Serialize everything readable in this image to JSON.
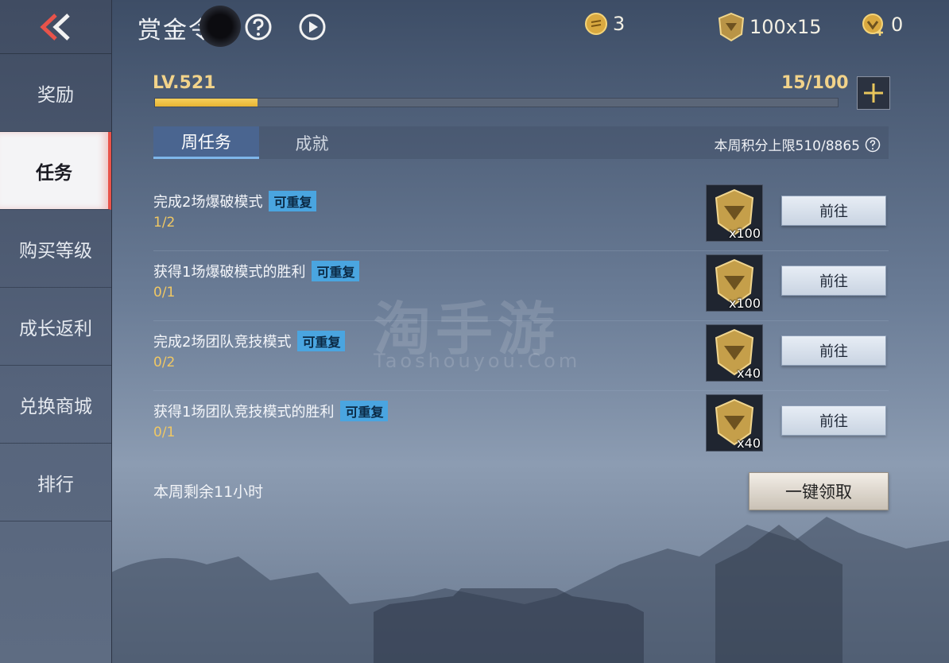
{
  "header": {
    "title": "赏金令",
    "currencies": [
      {
        "icon": "coin-icon",
        "value": "3"
      },
      {
        "icon": "medal-icon",
        "value": "100x15"
      },
      {
        "icon": "vip-coin-icon",
        "value": "0"
      }
    ]
  },
  "sidebar": {
    "items": [
      {
        "label": "奖励"
      },
      {
        "label": "任务"
      },
      {
        "label": "购买等级"
      },
      {
        "label": "成长返利"
      },
      {
        "label": "兑换商城"
      },
      {
        "label": "排行"
      }
    ]
  },
  "level": {
    "label": "LV.521",
    "count": "15/100",
    "progress": 0.15
  },
  "tabs": {
    "weekly": "周任务",
    "achievements": "成就",
    "weekly_limit": "本周积分上限510/8865"
  },
  "tasks": [
    {
      "title": "完成2场爆破模式",
      "tag": "可重复",
      "progress": "1/2",
      "reward_count": "x100",
      "button": "前往"
    },
    {
      "title": "获得1场爆破模式的胜利",
      "tag": "可重复",
      "progress": "0/1",
      "reward_count": "x100",
      "button": "前往"
    },
    {
      "title": "完成2场团队竞技模式",
      "tag": "可重复",
      "progress": "0/2",
      "reward_count": "x40",
      "button": "前往"
    },
    {
      "title": "获得1场团队竞技模式的胜利",
      "tag": "可重复",
      "progress": "0/1",
      "reward_count": "x40",
      "button": "前往"
    }
  ],
  "footer": {
    "remaining": "本周剩余11小时",
    "claim_all": "一键领取"
  },
  "watermark": {
    "main": "淘手游",
    "sub": "Taoshouyou.Com"
  },
  "colors": {
    "accent_gold": "#f2d38a",
    "tag_blue": "#4aa5e0",
    "active_tab": "#4a6590",
    "sidebar_active_marker": "#e8534a"
  }
}
